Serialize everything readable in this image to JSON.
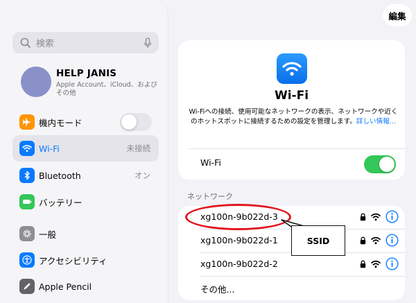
{
  "sidebar": {
    "search_placeholder": "検索",
    "profile": {
      "name": "HELP JANIS",
      "subtitle": "Apple Account、iCloud、および その他"
    },
    "items": [
      {
        "label": "機内モード",
        "icon": "airplane-icon",
        "color": "#ff9500",
        "control": "toggle",
        "toggle_on": false
      },
      {
        "label": "Wi-Fi",
        "value": "未接続",
        "icon": "wifi-icon",
        "color": "#0a7aff",
        "selected": true
      },
      {
        "label": "Bluetooth",
        "value": "オン",
        "icon": "bluetooth-icon",
        "color": "#0a7aff"
      },
      {
        "label": "バッテリー",
        "icon": "battery-icon",
        "color": "#34c759"
      },
      {
        "label": "一般",
        "icon": "gear-icon",
        "color": "#8e8e93"
      },
      {
        "label": "アクセシビリティ",
        "icon": "accessibility-icon",
        "color": "#0a7aff"
      },
      {
        "label": "Apple Pencil",
        "icon": "pencil-icon",
        "color": "#636366"
      }
    ]
  },
  "header": {
    "edit_label": "編集"
  },
  "wifi_panel": {
    "title": "Wi-Fi",
    "description": "Wi-Fiへの接続、使用可能なネットワークの表示、ネットワークや近くのホットスポットに接続するための設定を管理します。",
    "link_text": "詳しい情報...",
    "toggle_label": "Wi-Fi",
    "toggle_on": true
  },
  "networks": {
    "section_label": "ネットワーク",
    "items": [
      {
        "name": "xg100n-9b022d-3",
        "locked": true
      },
      {
        "name": "xg100n-9b022d-1",
        "locked": true
      },
      {
        "name": "xg100n-9b022d-2",
        "locked": true
      }
    ],
    "other_label": "その他..."
  },
  "annotation": {
    "callout_text": "SSID",
    "highlight_color": "#e2161e"
  },
  "colors": {
    "accent": "#0a7aff",
    "toggle_on": "#34c759"
  }
}
